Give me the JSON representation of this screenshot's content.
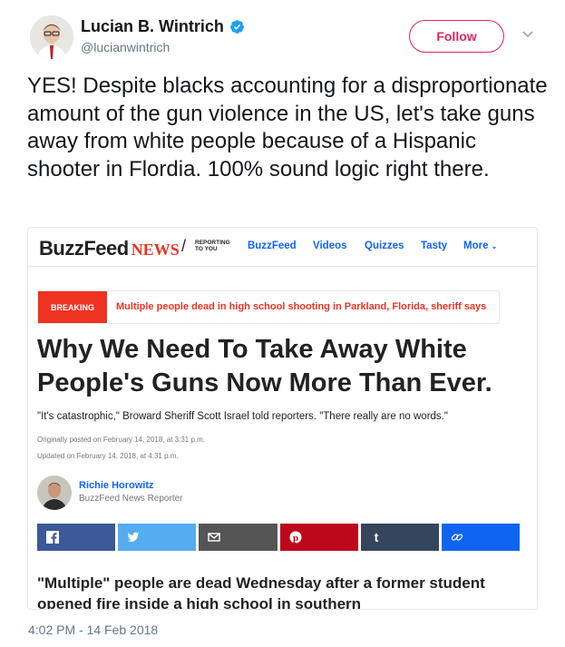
{
  "tweet": {
    "display_name": "Lucian B. Wintrich",
    "handle": "@lucianwintrich",
    "follow_label": "Follow",
    "text": "YES! Despite blacks accounting for a disproportionate amount of the gun violence in the US, let's take guns away from white people because of a Hispanic shooter in Flordia. 100% sound logic right there.",
    "timestamp": "4:02 PM - 14 Feb 2018"
  },
  "media": {
    "logo_buzz": "BuzzFeed",
    "logo_news": "NEWS",
    "logo_slash": "/",
    "logo_tagline": "REPORTING TO YOU",
    "nav": [
      "BuzzFeed",
      "Videos",
      "Quizzes",
      "Tasty",
      "More"
    ],
    "breaking_label": "BREAKING",
    "breaking_text": "Multiple people dead in high school shooting in Parkland, Florida, sheriff says",
    "headline": "Why We Need To Take Away White People's Guns Now More Than Ever.",
    "deck": "\"It's catastrophic,\" Broward Sheriff Scott Israel told reporters. \"There really are no words.\"",
    "posted": "Originally posted on February 14, 2018, at 3:31 p.m.",
    "updated": "Updated on February 14, 2018, at 4:31 p.m.",
    "author_name": "Richie Horowitz",
    "author_role": "BuzzFeed News Reporter",
    "share": [
      {
        "name": "facebook",
        "color": "#3b5998"
      },
      {
        "name": "twitter",
        "color": "#55acee"
      },
      {
        "name": "email",
        "color": "#555555"
      },
      {
        "name": "pinterest",
        "color": "#bd081c"
      },
      {
        "name": "tumblr",
        "color": "#35465c"
      },
      {
        "name": "link",
        "color": "#0f65ef"
      }
    ],
    "body": "\"Multiple\" people are dead Wednesday after a former student opened fire inside a high school in southern"
  },
  "colors": {
    "follow_accent": "#e0245e",
    "verified_blue": "#1da1f2",
    "buzzfeed_red": "#ee3322",
    "buzzfeed_blue": "#0f65ef"
  }
}
